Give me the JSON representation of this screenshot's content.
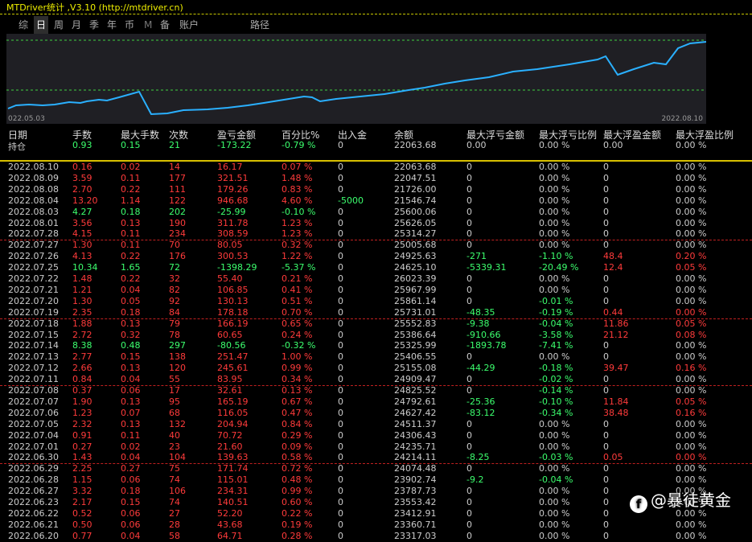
{
  "title": "MTDriver统计 ,V3.10 (http://mtdriver.cn)",
  "tabs": [
    {
      "label": "综",
      "active": false
    },
    {
      "label": "日",
      "active": true
    },
    {
      "label": "周",
      "active": false
    },
    {
      "label": "月",
      "active": false
    },
    {
      "label": "季",
      "active": false
    },
    {
      "label": "年",
      "active": false
    },
    {
      "label": "币",
      "active": false
    },
    {
      "label": "M",
      "active": false
    },
    {
      "label": "备",
      "active": false
    },
    {
      "label": "账户",
      "active": false
    },
    {
      "label": "路径",
      "active": false
    }
  ],
  "chart_data": {
    "type": "line",
    "x_start": "022.05.03",
    "x_end": "2022.08.10",
    "color": "#2ab0ff",
    "values": [
      21.5,
      21.8,
      21.8,
      21.7,
      21.7,
      21.9,
      21.8,
      22.1,
      22.0,
      22.2,
      22.4,
      22.3,
      22.6,
      22.8,
      22.9,
      23.1,
      23.0,
      23.2,
      23.4,
      23.6,
      23.8,
      24.0,
      24.1,
      24.3,
      24.5,
      24.7,
      24.8,
      25.0,
      25.1,
      25.3,
      25.4,
      25.6,
      24.9,
      25.2,
      25.7,
      25.6,
      26.0,
      26.2,
      26.0,
      26.7,
      27.0,
      27.3
    ],
    "dip_index": 10
  },
  "headers": [
    "日期",
    "手数",
    "最大手数",
    "次数",
    "盈亏金额",
    "百分比%",
    "出入金",
    "余额",
    "最大浮亏金额",
    "最大浮亏比例",
    "最大浮盈金额",
    "最大浮盈比例"
  ],
  "holding": {
    "label": "持仓",
    "lots": "0.93",
    "maxlots": "0.15",
    "count": "21",
    "pnl": "-173.22",
    "pct": "-0.79 %",
    "flow": "0",
    "balance": "22063.68",
    "maxloss": "0.00",
    "maxlosspct": "0.00 %",
    "maxgain": "0.00",
    "maxgainpct": "0.00 %"
  },
  "rows": [
    {
      "date": "2022.08.10",
      "lots": "0.16",
      "maxlots": "0.02",
      "count": "14",
      "pnl": "16.17",
      "pct": "0.07 %",
      "flow": "0",
      "balance": "22063.68",
      "maxloss": "0",
      "maxlosspct": "0.00 %",
      "maxgain": "0",
      "maxgainpct": "0.00 %",
      "color": "red",
      "cells": [
        "",
        "red",
        "red",
        "red",
        "red",
        "red",
        "",
        "",
        "",
        "",
        "",
        ""
      ]
    },
    {
      "date": "2022.08.09",
      "lots": "3.59",
      "maxlots": "0.11",
      "count": "177",
      "pnl": "321.51",
      "pct": "1.48 %",
      "flow": "0",
      "balance": "22047.51",
      "maxloss": "0",
      "maxlosspct": "0.00 %",
      "maxgain": "0",
      "maxgainpct": "0.00 %",
      "color": "red"
    },
    {
      "date": "2022.08.08",
      "lots": "2.70",
      "maxlots": "0.22",
      "count": "111",
      "pnl": "179.26",
      "pct": "0.83 %",
      "flow": "0",
      "balance": "21726.00",
      "maxloss": "0",
      "maxlosspct": "0.00 %",
      "maxgain": "0",
      "maxgainpct": "0.00 %",
      "color": "red"
    },
    {
      "date": "2022.08.04",
      "lots": "13.20",
      "maxlots": "1.14",
      "count": "122",
      "pnl": "946.68",
      "pct": "4.60 %",
      "flow": "-5000",
      "balance": "21546.74",
      "maxloss": "0",
      "maxlosspct": "0.00 %",
      "maxgain": "0",
      "maxgainpct": "0.00 %",
      "color": "red",
      "flowcolor": "green"
    },
    {
      "date": "2022.08.03",
      "lots": "4.27",
      "maxlots": "0.18",
      "count": "202",
      "pnl": "-25.99",
      "pct": "-0.10 %",
      "flow": "0",
      "balance": "25600.06",
      "maxloss": "0",
      "maxlosspct": "0.00 %",
      "maxgain": "0",
      "maxgainpct": "0.00 %",
      "color": "green"
    },
    {
      "date": "2022.08.01",
      "lots": "3.56",
      "maxlots": "0.13",
      "count": "190",
      "pnl": "311.78",
      "pct": "1.23 %",
      "flow": "0",
      "balance": "25626.05",
      "maxloss": "0",
      "maxlosspct": "0.00 %",
      "maxgain": "0",
      "maxgainpct": "0.00 %",
      "color": "red"
    },
    {
      "date": "2022.07.28",
      "lots": "4.15",
      "maxlots": "0.11",
      "count": "234",
      "pnl": "308.59",
      "pct": "1.23 %",
      "flow": "0",
      "balance": "25314.27",
      "maxloss": "0",
      "maxlosspct": "0.00 %",
      "maxgain": "0",
      "maxgainpct": "0.00 %",
      "color": "red",
      "sep": true
    },
    {
      "date": "2022.07.27",
      "lots": "1.30",
      "maxlots": "0.11",
      "count": "70",
      "pnl": "80.05",
      "pct": "0.32 %",
      "flow": "0",
      "balance": "25005.68",
      "maxloss": "0",
      "maxlosspct": "0.00 %",
      "maxgain": "0",
      "maxgainpct": "0.00 %",
      "color": "red"
    },
    {
      "date": "2022.07.26",
      "lots": "4.13",
      "maxlots": "0.22",
      "count": "176",
      "pnl": "300.53",
      "pct": "1.22 %",
      "flow": "0",
      "balance": "24925.63",
      "maxloss": "-271",
      "maxlosspct": "-1.10 %",
      "maxgain": "48.4",
      "maxgainpct": "0.20 %",
      "color": "red",
      "losscolor": "green",
      "gaincolor": "red"
    },
    {
      "date": "2022.07.25",
      "lots": "10.34",
      "maxlots": "1.65",
      "count": "72",
      "pnl": "-1398.29",
      "pct": "-5.37 %",
      "flow": "0",
      "balance": "24625.10",
      "maxloss": "-5339.31",
      "maxlosspct": "-20.49 %",
      "maxgain": "12.4",
      "maxgainpct": "0.05 %",
      "color": "green",
      "losscolor": "green",
      "gaincolor": "red"
    },
    {
      "date": "2022.07.22",
      "lots": "1.48",
      "maxlots": "0.22",
      "count": "32",
      "pnl": "55.40",
      "pct": "0.21 %",
      "flow": "0",
      "balance": "26023.39",
      "maxloss": "0",
      "maxlosspct": "0.00 %",
      "maxgain": "0",
      "maxgainpct": "0.00 %",
      "color": "red"
    },
    {
      "date": "2022.07.21",
      "lots": "1.21",
      "maxlots": "0.04",
      "count": "82",
      "pnl": "106.85",
      "pct": "0.41 %",
      "flow": "0",
      "balance": "25967.99",
      "maxloss": "0",
      "maxlosspct": "0.00 %",
      "maxgain": "0",
      "maxgainpct": "0.00 %",
      "color": "red"
    },
    {
      "date": "2022.07.20",
      "lots": "1.30",
      "maxlots": "0.05",
      "count": "92",
      "pnl": "130.13",
      "pct": "0.51 %",
      "flow": "0",
      "balance": "25861.14",
      "maxloss": "0",
      "maxlosspct": "-0.01 %",
      "maxgain": "0",
      "maxgainpct": "0.00 %",
      "color": "red",
      "losspctcolor": "green"
    },
    {
      "date": "2022.07.19",
      "lots": "2.35",
      "maxlots": "0.18",
      "count": "84",
      "pnl": "178.18",
      "pct": "0.70 %",
      "flow": "0",
      "balance": "25731.01",
      "maxloss": "-48.35",
      "maxlosspct": "-0.19 %",
      "maxgain": "0.44",
      "maxgainpct": "0.00 %",
      "color": "red",
      "losscolor": "green",
      "gaincolor": "red",
      "sep": true
    },
    {
      "date": "2022.07.18",
      "lots": "1.88",
      "maxlots": "0.13",
      "count": "79",
      "pnl": "166.19",
      "pct": "0.65 %",
      "flow": "0",
      "balance": "25552.83",
      "maxloss": "-9.38",
      "maxlosspct": "-0.04 %",
      "maxgain": "11.86",
      "maxgainpct": "0.05 %",
      "color": "red",
      "losscolor": "green",
      "gaincolor": "red"
    },
    {
      "date": "2022.07.15",
      "lots": "2.72",
      "maxlots": "0.32",
      "count": "78",
      "pnl": "60.65",
      "pct": "0.24 %",
      "flow": "0",
      "balance": "25386.64",
      "maxloss": "-910.66",
      "maxlosspct": "-3.58 %",
      "maxgain": "21.12",
      "maxgainpct": "0.08 %",
      "color": "red",
      "losscolor": "green",
      "gaincolor": "red"
    },
    {
      "date": "2022.07.14",
      "lots": "8.38",
      "maxlots": "0.48",
      "count": "297",
      "pnl": "-80.56",
      "pct": "-0.32 %",
      "flow": "0",
      "balance": "25325.99",
      "maxloss": "-1893.78",
      "maxlosspct": "-7.41 %",
      "maxgain": "0",
      "maxgainpct": "0.00 %",
      "color": "green",
      "losscolor": "green"
    },
    {
      "date": "2022.07.13",
      "lots": "2.77",
      "maxlots": "0.15",
      "count": "138",
      "pnl": "251.47",
      "pct": "1.00 %",
      "flow": "0",
      "balance": "25406.55",
      "maxloss": "0",
      "maxlosspct": "0.00 %",
      "maxgain": "0",
      "maxgainpct": "0.00 %",
      "color": "red"
    },
    {
      "date": "2022.07.12",
      "lots": "2.66",
      "maxlots": "0.13",
      "count": "120",
      "pnl": "245.61",
      "pct": "0.99 %",
      "flow": "0",
      "balance": "25155.08",
      "maxloss": "-44.29",
      "maxlosspct": "-0.18 %",
      "maxgain": "39.47",
      "maxgainpct": "0.16 %",
      "color": "red",
      "losscolor": "green",
      "gaincolor": "red"
    },
    {
      "date": "2022.07.11",
      "lots": "0.84",
      "maxlots": "0.04",
      "count": "55",
      "pnl": "83.95",
      "pct": "0.34 %",
      "flow": "0",
      "balance": "24909.47",
      "maxloss": "0",
      "maxlosspct": "-0.02 %",
      "maxgain": "0",
      "maxgainpct": "0.00 %",
      "color": "red",
      "losspctcolor": "green",
      "sep": true
    },
    {
      "date": "2022.07.08",
      "lots": "0.37",
      "maxlots": "0.06",
      "count": "17",
      "pnl": "32.61",
      "pct": "0.13 %",
      "flow": "0",
      "balance": "24825.52",
      "maxloss": "0",
      "maxlosspct": "-0.14 %",
      "maxgain": "0",
      "maxgainpct": "0.00 %",
      "color": "red",
      "losspctcolor": "green"
    },
    {
      "date": "2022.07.07",
      "lots": "1.90",
      "maxlots": "0.13",
      "count": "95",
      "pnl": "165.19",
      "pct": "0.67 %",
      "flow": "0",
      "balance": "24792.61",
      "maxloss": "-25.36",
      "maxlosspct": "-0.10 %",
      "maxgain": "11.84",
      "maxgainpct": "0.05 %",
      "color": "red",
      "losscolor": "green",
      "gaincolor": "red"
    },
    {
      "date": "2022.07.06",
      "lots": "1.23",
      "maxlots": "0.07",
      "count": "68",
      "pnl": "116.05",
      "pct": "0.47 %",
      "flow": "0",
      "balance": "24627.42",
      "maxloss": "-83.12",
      "maxlosspct": "-0.34 %",
      "maxgain": "38.48",
      "maxgainpct": "0.16 %",
      "color": "red",
      "losscolor": "green",
      "gaincolor": "red"
    },
    {
      "date": "2022.07.05",
      "lots": "2.32",
      "maxlots": "0.13",
      "count": "132",
      "pnl": "204.94",
      "pct": "0.84 %",
      "flow": "0",
      "balance": "24511.37",
      "maxloss": "0",
      "maxlosspct": "0.00 %",
      "maxgain": "0",
      "maxgainpct": "0.00 %",
      "color": "red"
    },
    {
      "date": "2022.07.04",
      "lots": "0.91",
      "maxlots": "0.11",
      "count": "40",
      "pnl": "70.72",
      "pct": "0.29 %",
      "flow": "0",
      "balance": "24306.43",
      "maxloss": "0",
      "maxlosspct": "0.00 %",
      "maxgain": "0",
      "maxgainpct": "0.00 %",
      "color": "red"
    },
    {
      "date": "2022.07.01",
      "lots": "0.27",
      "maxlots": "0.02",
      "count": "23",
      "pnl": "21.60",
      "pct": "0.09 %",
      "flow": "0",
      "balance": "24235.71",
      "maxloss": "0",
      "maxlosspct": "0.00 %",
      "maxgain": "0",
      "maxgainpct": "0.00 %",
      "color": "red"
    },
    {
      "date": "2022.06.30",
      "lots": "1.43",
      "maxlots": "0.04",
      "count": "104",
      "pnl": "139.63",
      "pct": "0.58 %",
      "flow": "0",
      "balance": "24214.11",
      "maxloss": "-8.25",
      "maxlosspct": "-0.03 %",
      "maxgain": "0.05",
      "maxgainpct": "0.00 %",
      "color": "red",
      "losscolor": "green",
      "gaincolor": "red",
      "sep": true
    },
    {
      "date": "2022.06.29",
      "lots": "2.25",
      "maxlots": "0.27",
      "count": "75",
      "pnl": "171.74",
      "pct": "0.72 %",
      "flow": "0",
      "balance": "24074.48",
      "maxloss": "0",
      "maxlosspct": "0.00 %",
      "maxgain": "0",
      "maxgainpct": "0.00 %",
      "color": "red"
    },
    {
      "date": "2022.06.28",
      "lots": "1.15",
      "maxlots": "0.06",
      "count": "74",
      "pnl": "115.01",
      "pct": "0.48 %",
      "flow": "0",
      "balance": "23902.74",
      "maxloss": "-9.2",
      "maxlosspct": "-0.04 %",
      "maxgain": "0",
      "maxgainpct": "0.00 %",
      "color": "red",
      "losscolor": "green"
    },
    {
      "date": "2022.06.27",
      "lots": "3.32",
      "maxlots": "0.18",
      "count": "106",
      "pnl": "234.31",
      "pct": "0.99 %",
      "flow": "0",
      "balance": "23787.73",
      "maxloss": "0",
      "maxlosspct": "0.00 %",
      "maxgain": "0",
      "maxgainpct": "0.00 %",
      "color": "red"
    },
    {
      "date": "2022.06.23",
      "lots": "2.17",
      "maxlots": "0.15",
      "count": "74",
      "pnl": "140.51",
      "pct": "0.60 %",
      "flow": "0",
      "balance": "23553.42",
      "maxloss": "0",
      "maxlosspct": "0.00 %",
      "maxgain": "0",
      "maxgainpct": "0.00 %",
      "color": "red"
    },
    {
      "date": "2022.06.22",
      "lots": "0.52",
      "maxlots": "0.06",
      "count": "27",
      "pnl": "52.20",
      "pct": "0.22 %",
      "flow": "0",
      "balance": "23412.91",
      "maxloss": "0",
      "maxlosspct": "0.00 %",
      "maxgain": "0",
      "maxgainpct": "0.00 %",
      "color": "red"
    },
    {
      "date": "2022.06.21",
      "lots": "0.50",
      "maxlots": "0.06",
      "count": "28",
      "pnl": "43.68",
      "pct": "0.19 %",
      "flow": "0",
      "balance": "23360.71",
      "maxloss": "0",
      "maxlosspct": "0.00 %",
      "maxgain": "0",
      "maxgainpct": "0.00 %",
      "color": "red"
    },
    {
      "date": "2022.06.20",
      "lots": "0.77",
      "maxlots": "0.04",
      "count": "58",
      "pnl": "64.71",
      "pct": "0.28 %",
      "flow": "0",
      "balance": "23317.03",
      "maxloss": "0",
      "maxlosspct": "0.00 %",
      "maxgain": "0",
      "maxgainpct": "0.00 %",
      "color": "red"
    }
  ],
  "watermark": "@暴徒黄金",
  "watermark_icon": "f-logo-icon"
}
